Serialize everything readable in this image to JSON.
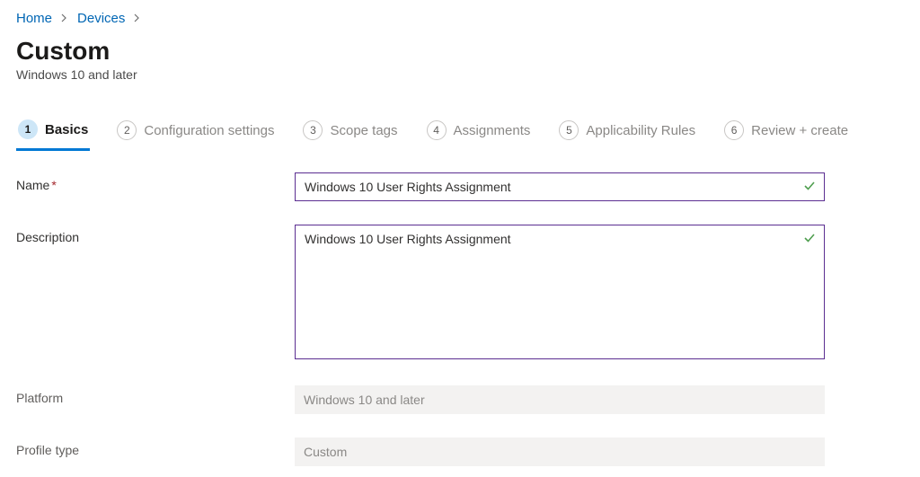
{
  "breadcrumb": {
    "home": "Home",
    "devices": "Devices"
  },
  "header": {
    "title": "Custom",
    "subtitle": "Windows 10 and later"
  },
  "steps": [
    {
      "num": "1",
      "label": "Basics"
    },
    {
      "num": "2",
      "label": "Configuration settings"
    },
    {
      "num": "3",
      "label": "Scope tags"
    },
    {
      "num": "4",
      "label": "Assignments"
    },
    {
      "num": "5",
      "label": "Applicability Rules"
    },
    {
      "num": "6",
      "label": "Review + create"
    }
  ],
  "form": {
    "name_label": "Name",
    "name_value": "Windows 10 User Rights Assignment",
    "description_label": "Description",
    "description_value": "Windows 10 User Rights Assignment",
    "platform_label": "Platform",
    "platform_value": "Windows 10 and later",
    "profile_type_label": "Profile type",
    "profile_type_value": "Custom"
  }
}
